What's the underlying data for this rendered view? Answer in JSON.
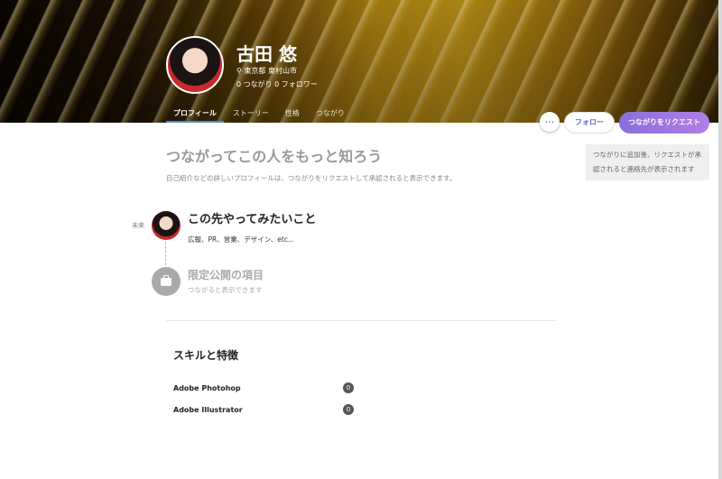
{
  "profile": {
    "name": "古田 悠",
    "location": "東京都 東村山市",
    "counts": "0 つながり  0 フォロワー"
  },
  "tabs": [
    {
      "label": "プロフィール",
      "active": true
    },
    {
      "label": "ストーリー",
      "active": false
    },
    {
      "label": "性格",
      "active": false
    },
    {
      "label": "つながり",
      "active": false
    }
  ],
  "actions": {
    "more": "…",
    "follow": "フォロー",
    "connect": "つながりをリクエスト"
  },
  "side_note": "つながりに追加後、リクエストが承認されると連絡先が表示されます",
  "main": {
    "title": "つながってこの人をもっと知ろう",
    "subtitle": "自己紹介などの詳しいプロフィールは、つながりをリクエストして承認されると表示できます。"
  },
  "timeline": {
    "label": "未来",
    "want_title": "この先やってみたいこと",
    "want_body": "広報、PR、営業、デザイン、etc...",
    "limited_title": "限定公開の項目",
    "limited_sub": "つながると表示できます"
  },
  "skills": {
    "title": "スキルと特徴",
    "items": [
      {
        "name": "Adobe Photohop",
        "count": "0"
      },
      {
        "name": "Adobe Illustrator",
        "count": "0"
      }
    ]
  },
  "colors": {
    "accent": "#5a5fcf",
    "tab_indicator": "#4a90c8",
    "connect_gradient_start": "#8a6ed8",
    "connect_gradient_end": "#b07ee6"
  }
}
